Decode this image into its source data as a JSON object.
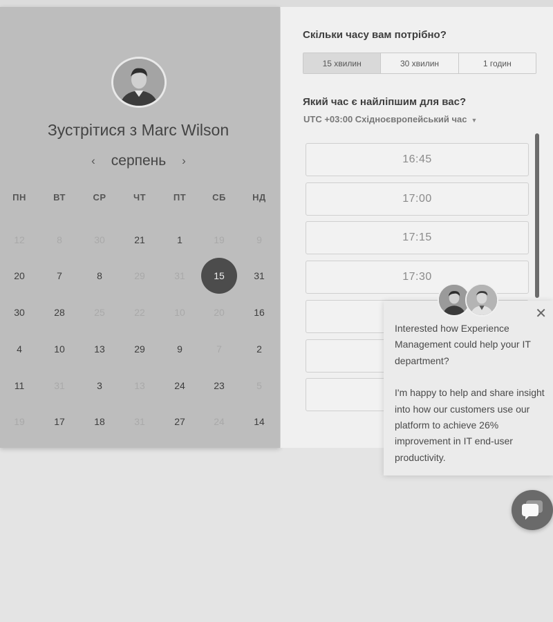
{
  "calendar": {
    "title": "Зустрітися з Marc Wilson",
    "month": "серпень",
    "prev_icon": "‹",
    "next_icon": "›",
    "weekdays": [
      "ПН",
      "ВТ",
      "СР",
      "ЧТ",
      "ПТ",
      "СБ",
      "НД"
    ],
    "weeks": [
      [
        {
          "d": "12",
          "m": true
        },
        {
          "d": "8",
          "m": true
        },
        {
          "d": "30",
          "m": true
        },
        {
          "d": "21",
          "m": false
        },
        {
          "d": "1",
          "m": false
        },
        {
          "d": "19",
          "m": true
        },
        {
          "d": "9",
          "m": true
        }
      ],
      [
        {
          "d": "20",
          "m": false
        },
        {
          "d": "7",
          "m": false
        },
        {
          "d": "8",
          "m": false
        },
        {
          "d": "29",
          "m": true
        },
        {
          "d": "31",
          "m": true
        },
        {
          "d": "15",
          "m": false,
          "selected": true
        },
        {
          "d": "31",
          "m": false
        }
      ],
      [
        {
          "d": "30",
          "m": false
        },
        {
          "d": "28",
          "m": false
        },
        {
          "d": "25",
          "m": true
        },
        {
          "d": "22",
          "m": true
        },
        {
          "d": "10",
          "m": true
        },
        {
          "d": "20",
          "m": true
        },
        {
          "d": "16",
          "m": false
        }
      ],
      [
        {
          "d": "4",
          "m": false
        },
        {
          "d": "10",
          "m": false
        },
        {
          "d": "13",
          "m": false
        },
        {
          "d": "29",
          "m": false
        },
        {
          "d": "9",
          "m": false
        },
        {
          "d": "7",
          "m": true
        },
        {
          "d": "2",
          "m": false
        }
      ],
      [
        {
          "d": "11",
          "m": false
        },
        {
          "d": "31",
          "m": true
        },
        {
          "d": "3",
          "m": false
        },
        {
          "d": "13",
          "m": true
        },
        {
          "d": "24",
          "m": false
        },
        {
          "d": "23",
          "m": false
        },
        {
          "d": "5",
          "m": true
        }
      ],
      [
        {
          "d": "19",
          "m": true
        },
        {
          "d": "17",
          "m": false
        },
        {
          "d": "18",
          "m": false
        },
        {
          "d": "31",
          "m": true
        },
        {
          "d": "27",
          "m": false
        },
        {
          "d": "24",
          "m": true
        },
        {
          "d": "14",
          "m": false
        }
      ]
    ]
  },
  "scheduler": {
    "duration_question": "Скільки часу вам потрібно?",
    "durations": [
      "15 хвилин",
      "30 хвилин",
      "1 годин"
    ],
    "active_duration_index": 0,
    "time_question": "Який час є найліпшим для вас?",
    "timezone": "UTC +03:00 Східноєвропейський час",
    "timezone_caret": "▼",
    "slots": [
      "16:45",
      "17:00",
      "17:15",
      "17:30",
      "",
      "",
      "",
      ""
    ]
  },
  "chat_popup": {
    "close_icon": "✕",
    "paragraph1": "Interested how Experience Management could help your IT department?",
    "paragraph2": "I'm happy to help and share insight into how our customers use our platform to achieve 26% improvement in IT end-user productivity."
  },
  "colors": {
    "selected_day": "#4c4c4c",
    "left_panel": "#bdbdbd",
    "right_panel": "#f0f0f0"
  }
}
